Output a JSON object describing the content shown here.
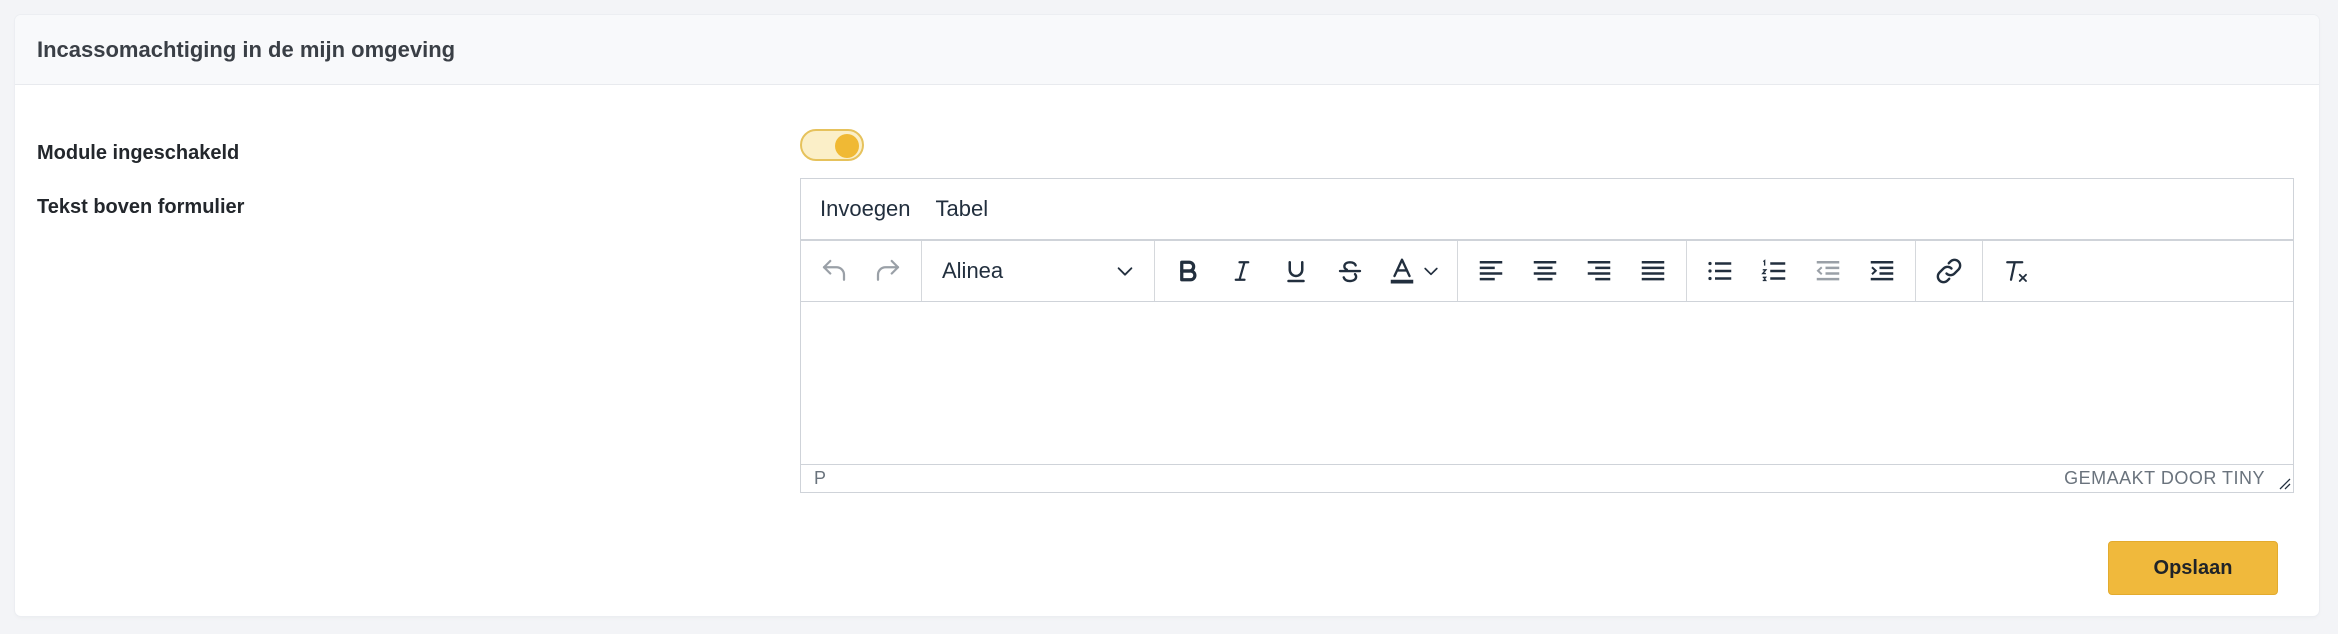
{
  "card": {
    "title": "Incassomachtiging in de mijn omgeving"
  },
  "form": {
    "module_label": "Module ingeschakeld",
    "module_enabled": true,
    "text_label": "Tekst boven formulier"
  },
  "editor": {
    "menu": [
      "Invoegen",
      "Tabel"
    ],
    "block_format": "Alinea",
    "status_path": "P",
    "branding": "GEMAAKT DOOR TINY"
  },
  "actions": {
    "save_label": "Opslaan"
  },
  "colors": {
    "accent": "#f0b93c",
    "toggle_track": "#fbefc8"
  }
}
